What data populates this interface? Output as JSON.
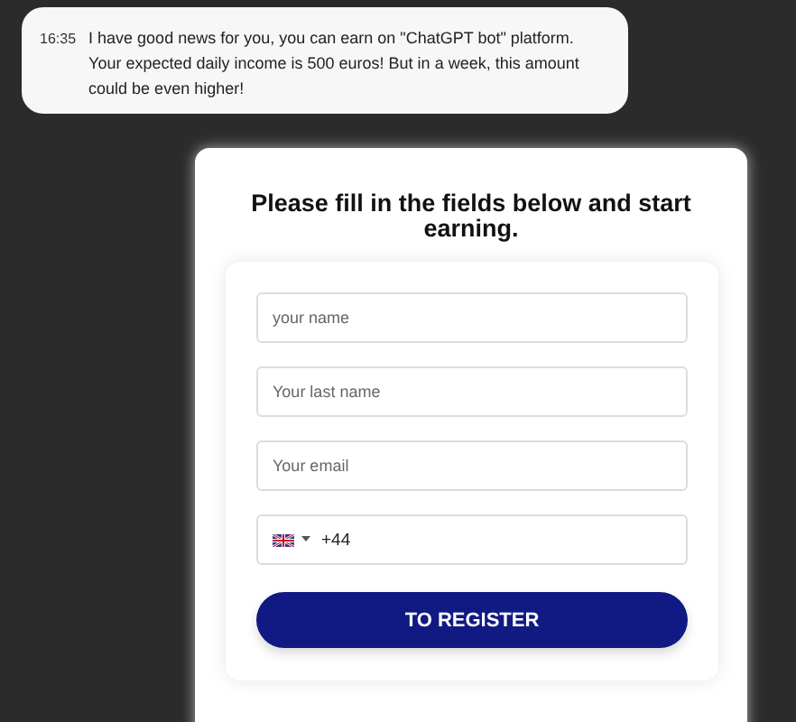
{
  "message": {
    "time": "16:35",
    "text": "I have good news for you, you can earn on \"ChatGPT bot\" platform. Your expected daily income is 500 euros! But in a week, this amount could be even higher!"
  },
  "form": {
    "title": "Please fill in the fields below and start earning.",
    "fields": [
      {
        "kind": "text",
        "placeholder": "your name"
      },
      {
        "kind": "text",
        "placeholder": "Your last name"
      },
      {
        "kind": "text",
        "placeholder": "Your email"
      },
      {
        "kind": "phone",
        "value": "+44"
      }
    ],
    "button": "TO REGISTER"
  }
}
